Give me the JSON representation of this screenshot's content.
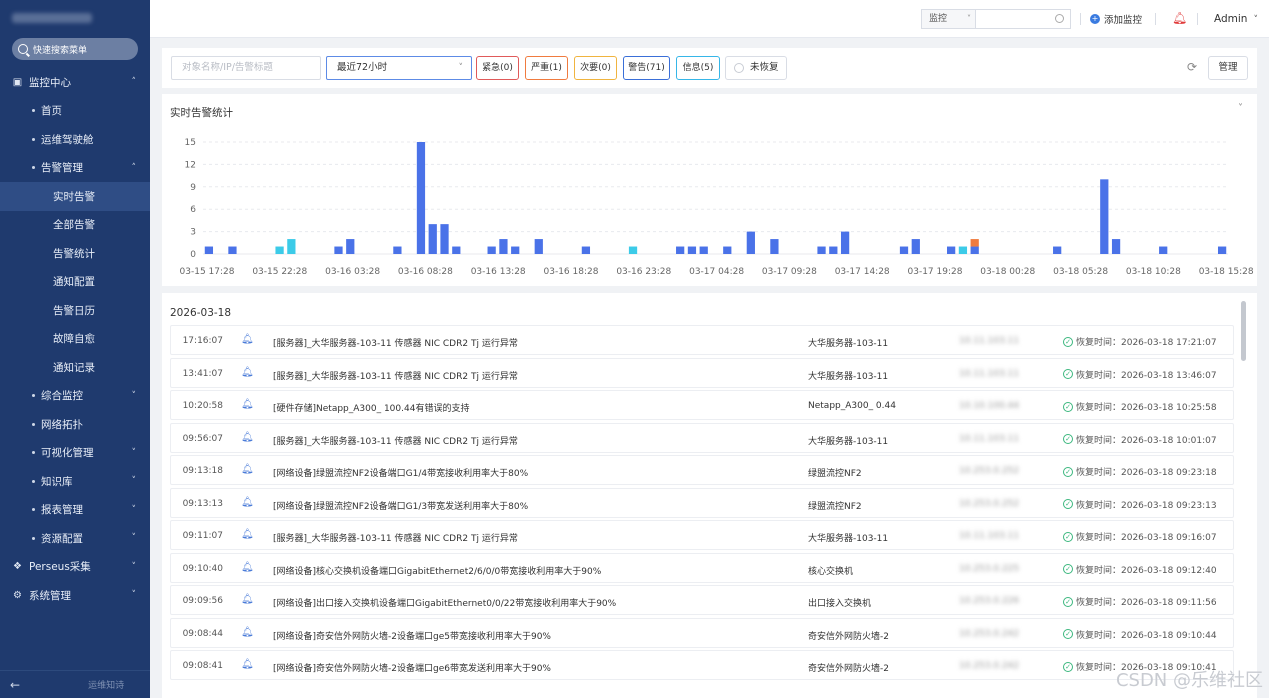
{
  "sidebar": {
    "search_placeholder": "快速搜索菜单",
    "items": [
      {
        "label": "监控中心",
        "level": 0,
        "icon": "monitor-icon",
        "chev": "˄"
      },
      {
        "label": "首页",
        "level": 1
      },
      {
        "label": "运维驾驶舱",
        "level": 1
      },
      {
        "label": "告警管理",
        "level": 1,
        "chev": "˄"
      },
      {
        "label": "实时告警",
        "level": 2,
        "active": true
      },
      {
        "label": "全部告警",
        "level": 2
      },
      {
        "label": "告警统计",
        "level": 2
      },
      {
        "label": "通知配置",
        "level": 2
      },
      {
        "label": "告警日历",
        "level": 2
      },
      {
        "label": "故障自愈",
        "level": 2
      },
      {
        "label": "通知记录",
        "level": 2
      },
      {
        "label": "综合监控",
        "level": 1,
        "chev": "˅"
      },
      {
        "label": "网络拓扑",
        "level": 1
      },
      {
        "label": "可视化管理",
        "level": 1,
        "chev": "˅"
      },
      {
        "label": "知识库",
        "level": 1,
        "chev": "˅"
      },
      {
        "label": "报表管理",
        "level": 1,
        "chev": "˅"
      },
      {
        "label": "资源配置",
        "level": 1,
        "chev": "˅"
      },
      {
        "label": "Perseus采集",
        "level": 0,
        "icon": "collect-icon",
        "chev": "˅"
      },
      {
        "label": "系统管理",
        "level": 0,
        "icon": "gear-icon",
        "chev": "˅"
      }
    ],
    "footer_label": "运维知诗"
  },
  "topbar": {
    "select_value": "监控",
    "add_label": "添加监控",
    "user_name": "Admin"
  },
  "filter": {
    "input_placeholder": "对象名称/IP/告警标题",
    "range_value": "最近72小时",
    "severities": [
      {
        "label": "紧急(0)",
        "color": "#e05a5a"
      },
      {
        "label": "严重(1)",
        "color": "#f07b3f"
      },
      {
        "label": "次要(0)",
        "color": "#f0b43f"
      },
      {
        "label": "警告(71)",
        "color": "#3a6fd8"
      },
      {
        "label": "信息(5)",
        "color": "#36b6e8"
      }
    ],
    "unrecovered_label": "未恢复",
    "manage_label": "管理"
  },
  "chart_panel": {
    "title": "实时告警统计"
  },
  "chart_data": {
    "type": "bar",
    "title": "实时告警统计",
    "ylim": [
      0,
      15
    ],
    "yticks": [
      0,
      3,
      6,
      9,
      12,
      15
    ],
    "xtick_labels": [
      "03-15 17:28",
      "03-15 22:28",
      "03-16 03:28",
      "03-16 08:28",
      "03-16 13:28",
      "03-16 18:28",
      "03-16 23:28",
      "03-17 04:28",
      "03-17 09:28",
      "03-17 14:28",
      "03-17 19:28",
      "03-18 00:28",
      "03-18 05:28",
      "03-18 10:28",
      "03-18 15:28"
    ],
    "bin_count": 87,
    "series": [
      {
        "color": "#4a72e8",
        "bins": [
          [
            0,
            1
          ],
          [
            2,
            1
          ],
          [
            11,
            1
          ],
          [
            12,
            2
          ],
          [
            16,
            1
          ],
          [
            18,
            15
          ],
          [
            19,
            4
          ],
          [
            20,
            4
          ],
          [
            21,
            1
          ],
          [
            24,
            1
          ],
          [
            25,
            2
          ],
          [
            26,
            1
          ],
          [
            28,
            2
          ],
          [
            32,
            1
          ],
          [
            40,
            1
          ],
          [
            41,
            1
          ],
          [
            42,
            1
          ],
          [
            44,
            1
          ],
          [
            46,
            3
          ],
          [
            48,
            2
          ],
          [
            52,
            1
          ],
          [
            53,
            1
          ],
          [
            54,
            3
          ],
          [
            59,
            1
          ],
          [
            60,
            2
          ],
          [
            63,
            1
          ],
          [
            65,
            1
          ],
          [
            72,
            1
          ],
          [
            76,
            10
          ],
          [
            77,
            2
          ],
          [
            81,
            1
          ],
          [
            86,
            1
          ]
        ]
      },
      {
        "color": "#3ccbe8",
        "bins": [
          [
            6,
            1
          ],
          [
            7,
            2
          ],
          [
            36,
            1
          ],
          [
            64,
            1
          ]
        ]
      },
      {
        "color": "#f07b3f",
        "bins": [
          [
            65,
            1
          ]
        ]
      }
    ]
  },
  "list": {
    "date": "2026-03-18",
    "rows": [
      {
        "time": "17:16:07",
        "msg": "[服务器]_大华服务器-103-11 传感器 NIC CDR2 Tj 运行异常",
        "obj": "大华服务器-103-11",
        "ip": "10.11.103.11",
        "recovery": "恢复时间：2026-03-18 17:21:07"
      },
      {
        "time": "13:41:07",
        "msg": "[服务器]_大华服务器-103-11 传感器 NIC CDR2 Tj 运行异常",
        "obj": "大华服务器-103-11",
        "ip": "10.11.103.11",
        "recovery": "恢复时间：2026-03-18 13:46:07"
      },
      {
        "time": "10:20:58",
        "msg": "[硬件存储]Netapp_A300_      100.44有错误的支持",
        "obj": "Netapp_A300_      0.44",
        "ip": "10.10.100.44",
        "recovery": "恢复时间：2026-03-18 10:25:58"
      },
      {
        "time": "09:56:07",
        "msg": "[服务器]_大华服务器-103-11 传感器 NIC CDR2 Tj 运行异常",
        "obj": "大华服务器-103-11",
        "ip": "10.11.103.11",
        "recovery": "恢复时间：2026-03-18 10:01:07"
      },
      {
        "time": "09:13:18",
        "msg": "[网络设备]绿盟流控NF2设备端口G1/4带宽接收利用率大于80%",
        "obj": "绿盟流控NF2",
        "ip": "10.253.0.252",
        "recovery": "恢复时间：2026-03-18 09:23:18"
      },
      {
        "time": "09:13:13",
        "msg": "[网络设备]绿盟流控NF2设备端口G1/3带宽发送利用率大于80%",
        "obj": "绿盟流控NF2",
        "ip": "10.253.0.252",
        "recovery": "恢复时间：2026-03-18 09:23:13"
      },
      {
        "time": "09:11:07",
        "msg": "[服务器]_大华服务器-103-11 传感器 NIC CDR2 Tj 运行异常",
        "obj": "大华服务器-103-11",
        "ip": "10.11.103.11",
        "recovery": "恢复时间：2026-03-18 09:16:07"
      },
      {
        "time": "09:10:40",
        "msg": "[网络设备]核心交换机设备端口GigabitEthernet2/6/0/0带宽接收利用率大于90%",
        "obj": "核心交换机",
        "ip": "10.253.0.225",
        "recovery": "恢复时间：2026-03-18 09:12:40"
      },
      {
        "time": "09:09:56",
        "msg": "[网络设备]出口接入交换机设备端口GigabitEthernet0/0/22带宽接收利用率大于90%",
        "obj": "出口接入交换机",
        "ip": "10.253.0.226",
        "recovery": "恢复时间：2026-03-18 09:11:56"
      },
      {
        "time": "09:08:44",
        "msg": "[网络设备]奇安信外网防火墙-2设备端口ge5带宽接收利用率大于90%",
        "obj": "奇安信外网防火墙-2",
        "ip": "10.253.0.242",
        "recovery": "恢复时间：2026-03-18 09:10:44"
      },
      {
        "time": "09:08:41",
        "msg": "[网络设备]奇安信外网防火墙-2设备端口ge6带宽发送利用率大于90%",
        "obj": "奇安信外网防火墙-2",
        "ip": "10.253.0.242",
        "recovery": "恢复时间：2026-03-18 09:10:41"
      }
    ]
  },
  "watermark": "CSDN @乐维社区"
}
